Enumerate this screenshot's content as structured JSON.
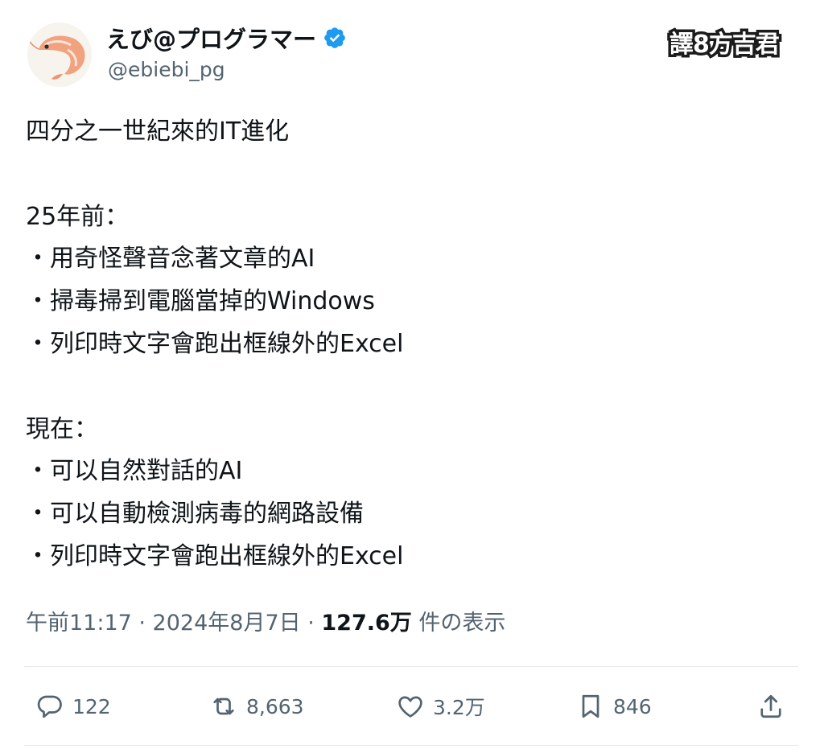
{
  "author": {
    "display_name": "えび@プログラマー",
    "handle": "@ebiebi_pg",
    "verified_icon": "verified-badge-icon",
    "avatar_icon": "shrimp-avatar"
  },
  "watermark": "譯8方吉君",
  "tweet": {
    "lines": [
      "四分之一世紀來的IT進化",
      "",
      "25年前：",
      "・用奇怪聲音念著文章的AI",
      "・掃毒掃到電腦當掉的Windows",
      "・列印時文字會跑出框線外的Excel",
      "",
      "現在：",
      "・可以自然對話的AI",
      "・可以自動檢測病毒的網路設備",
      "・列印時文字會跑出框線外的Excel"
    ]
  },
  "meta": {
    "time_date": "午前11:17 · 2024年8月7日 · ",
    "views": "127.6万",
    "views_label": " 件の表示"
  },
  "actions": {
    "reply": {
      "icon": "reply-icon",
      "count": "122"
    },
    "retweet": {
      "icon": "retweet-icon",
      "count": "8,663"
    },
    "like": {
      "icon": "heart-icon",
      "count": "3.2万"
    },
    "bookmark": {
      "icon": "bookmark-icon",
      "count": "846"
    },
    "share": {
      "icon": "share-icon"
    }
  },
  "colors": {
    "text": "#0f1419",
    "muted": "#536471",
    "verified": "#1d9bf0",
    "divider": "#e6e9eb"
  }
}
